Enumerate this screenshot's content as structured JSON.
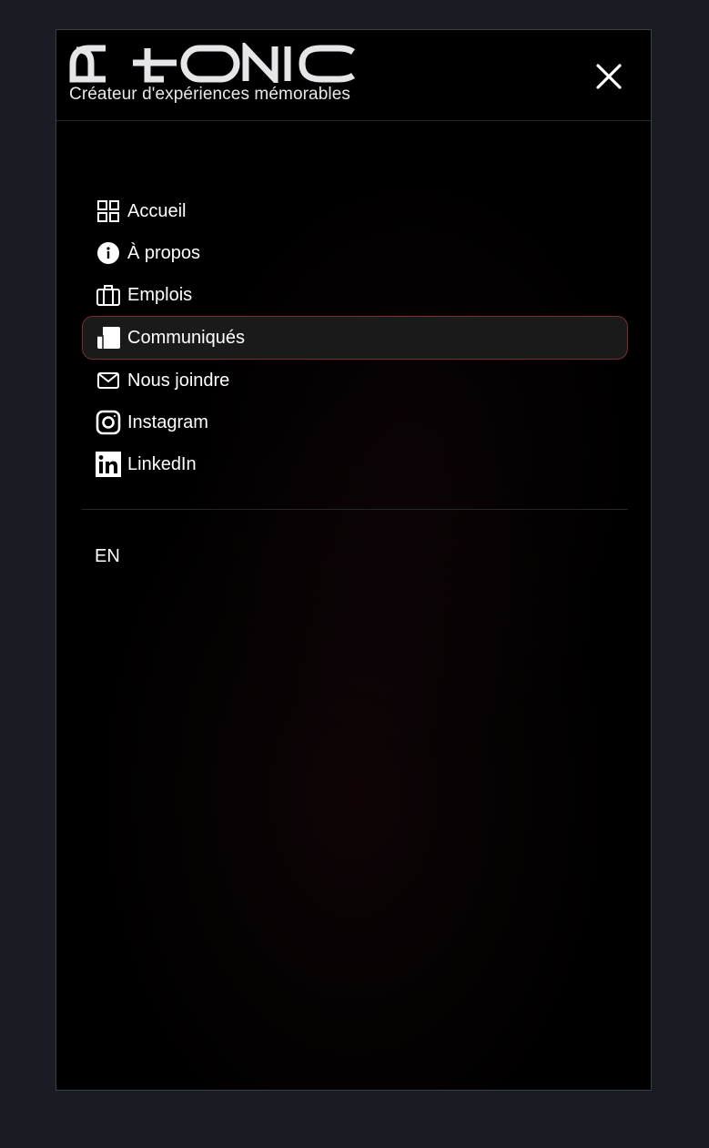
{
  "brand": {
    "logo_text": "G+ONIC",
    "tagline": "Créateur d'expériences mémorables"
  },
  "header": {
    "close_icon": "close-icon"
  },
  "nav": {
    "items": [
      {
        "label": "Accueil",
        "icon": "grid-icon"
      },
      {
        "label": "À propos",
        "icon": "info-icon"
      },
      {
        "label": "Emplois",
        "icon": "briefcase-icon"
      },
      {
        "label": "Communiqués",
        "icon": "newspaper-icon",
        "active": true
      },
      {
        "label": "Nous joindre",
        "icon": "mail-icon"
      },
      {
        "label": "Instagram",
        "icon": "instagram-icon"
      },
      {
        "label": "LinkedIn",
        "icon": "linkedin-icon"
      }
    ]
  },
  "language": {
    "label": "EN"
  },
  "colors": {
    "background": "#1a1c24",
    "panel": "#000000",
    "text": "#ffffff",
    "active_border": "#7a2e2e",
    "active_bg": "#1b1a1b"
  }
}
